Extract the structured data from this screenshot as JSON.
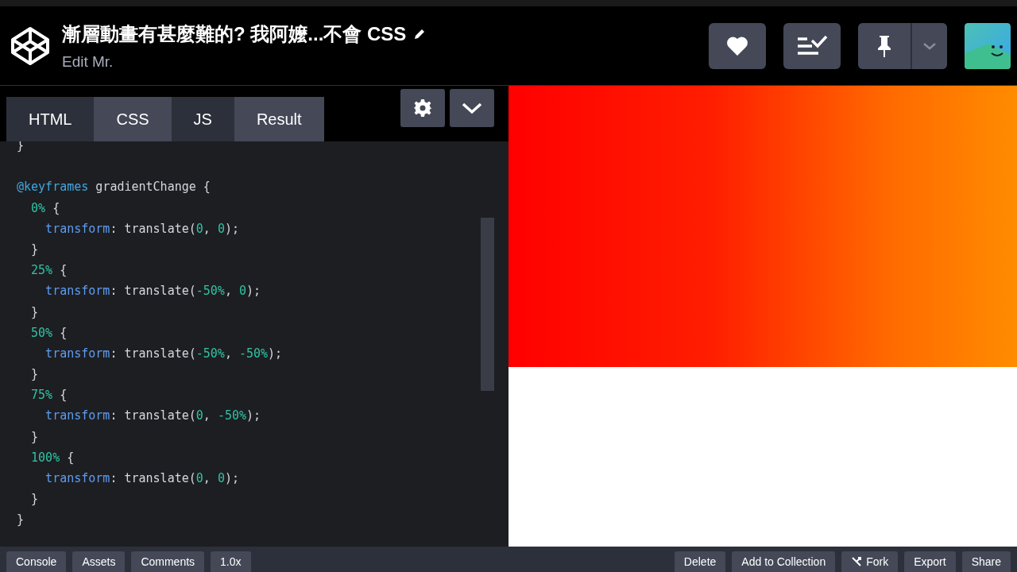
{
  "header": {
    "title": "漸層動畫有甚麼難的? 我阿嬤...不會 CSS",
    "subtitle": "Edit Mr."
  },
  "tabs": [
    {
      "label": "HTML",
      "selected": false
    },
    {
      "label": "CSS",
      "selected": true
    },
    {
      "label": "JS",
      "selected": false
    },
    {
      "label": "Result",
      "selected": true
    }
  ],
  "code": [
    [
      {
        "text": "}",
        "kind": "plain"
      }
    ],
    [
      {
        "kind": "blank"
      }
    ],
    [
      {
        "text": "@keyframes",
        "kind": "keyword"
      },
      {
        "text": " gradientChange {",
        "kind": "plain"
      }
    ],
    [
      {
        "text": "  0%",
        "kind": "number"
      },
      {
        "text": " {",
        "kind": "plain"
      }
    ],
    [
      {
        "text": "    transform",
        "kind": "property"
      },
      {
        "text": ": translate(",
        "kind": "plain"
      },
      {
        "text": "0",
        "kind": "number"
      },
      {
        "text": ", ",
        "kind": "plain"
      },
      {
        "text": "0",
        "kind": "number"
      },
      {
        "text": ");",
        "kind": "plain"
      }
    ],
    [
      {
        "text": "  }",
        "kind": "plain"
      }
    ],
    [
      {
        "text": "  25%",
        "kind": "number"
      },
      {
        "text": " {",
        "kind": "plain"
      }
    ],
    [
      {
        "text": "    transform",
        "kind": "property"
      },
      {
        "text": ": translate(",
        "kind": "plain"
      },
      {
        "text": "-50%",
        "kind": "number"
      },
      {
        "text": ", ",
        "kind": "plain"
      },
      {
        "text": "0",
        "kind": "number"
      },
      {
        "text": ");",
        "kind": "plain"
      }
    ],
    [
      {
        "text": "  }",
        "kind": "plain"
      }
    ],
    [
      {
        "text": "  50%",
        "kind": "number"
      },
      {
        "text": " {",
        "kind": "plain"
      }
    ],
    [
      {
        "text": "    transform",
        "kind": "property"
      },
      {
        "text": ": translate(",
        "kind": "plain"
      },
      {
        "text": "-50%",
        "kind": "number"
      },
      {
        "text": ", ",
        "kind": "plain"
      },
      {
        "text": "-50%",
        "kind": "number"
      },
      {
        "text": ");",
        "kind": "plain"
      }
    ],
    [
      {
        "text": "  }",
        "kind": "plain"
      }
    ],
    [
      {
        "text": "  75%",
        "kind": "number"
      },
      {
        "text": " {",
        "kind": "plain"
      }
    ],
    [
      {
        "text": "    transform",
        "kind": "property"
      },
      {
        "text": ": translate(",
        "kind": "plain"
      },
      {
        "text": "0",
        "kind": "number"
      },
      {
        "text": ", ",
        "kind": "plain"
      },
      {
        "text": "-50%",
        "kind": "number"
      },
      {
        "text": ");",
        "kind": "plain"
      }
    ],
    [
      {
        "text": "  }",
        "kind": "plain"
      }
    ],
    [
      {
        "text": "  100%",
        "kind": "number"
      },
      {
        "text": " {",
        "kind": "plain"
      }
    ],
    [
      {
        "text": "    transform",
        "kind": "property"
      },
      {
        "text": ": translate(",
        "kind": "plain"
      },
      {
        "text": "0",
        "kind": "number"
      },
      {
        "text": ", ",
        "kind": "plain"
      },
      {
        "text": "0",
        "kind": "number"
      },
      {
        "text": ");",
        "kind": "plain"
      }
    ],
    [
      {
        "text": "  }",
        "kind": "plain"
      }
    ],
    [
      {
        "text": "}",
        "kind": "plain"
      }
    ]
  ],
  "footer": {
    "left_buttons": [
      "Console",
      "Assets",
      "Comments",
      "1.0x"
    ],
    "right_buttons": [
      {
        "label": "Delete",
        "kind": "text"
      },
      {
        "label": "Add to Collection",
        "kind": "text"
      },
      {
        "label": "Fork",
        "kind": "fork"
      },
      {
        "label": "Export",
        "kind": "text"
      },
      {
        "label": "Share",
        "kind": "text"
      }
    ]
  }
}
